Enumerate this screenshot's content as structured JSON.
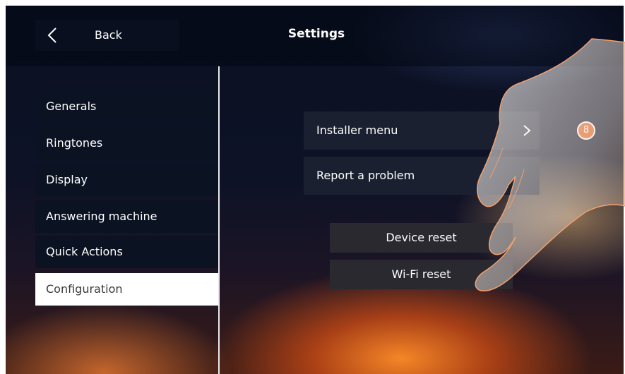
{
  "header": {
    "back_label": "Back",
    "title": "Settings",
    "back_icon": "chevron-left-icon"
  },
  "sidebar": {
    "items": [
      {
        "label": "Generals",
        "active": false
      },
      {
        "label": "Ringtones",
        "active": false
      },
      {
        "label": "Display",
        "active": false
      },
      {
        "label": "Answering machine",
        "active": false
      },
      {
        "label": "Quick Actions",
        "active": false
      },
      {
        "label": "Configuration",
        "active": true
      }
    ]
  },
  "main": {
    "installer_menu_label": "Installer menu",
    "report_problem_label": "Report a problem",
    "device_reset_label": "Device reset",
    "wifi_reset_label": "Wi-Fi reset",
    "step_badge": "8"
  },
  "colors": {
    "accent": "#e05d1a",
    "active_item_bg": "#ffffff"
  }
}
